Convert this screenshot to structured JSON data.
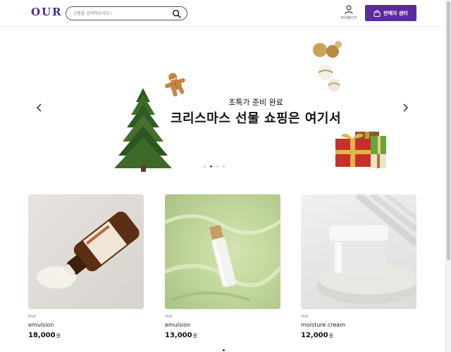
{
  "header": {
    "logo": "OUR",
    "search_placeholder": "상품을 검색해보세요 !",
    "mypage_label": "마이페이지",
    "seller_center_label": "판매자 센터"
  },
  "banner": {
    "subtitle": "초특가 준비 완료",
    "title": "크리스마스 선물 쇼핑은 여기서",
    "slide_count": 4,
    "active_slide": 2
  },
  "products": [
    {
      "brand": "our",
      "name": "emulsion",
      "price": "18,000",
      "currency": "원"
    },
    {
      "brand": "our",
      "name": "emulsion",
      "price": "13,000",
      "currency": "원"
    },
    {
      "brand": "our",
      "name": "moisture cream",
      "price": "12,000",
      "currency": "원"
    }
  ],
  "colors": {
    "brand_purple": "#5b2a9c",
    "logo_purple": "#4b2a8a",
    "moon_yellow": "#f2c230"
  },
  "icons": {
    "search": "search-icon",
    "moon": "moon-icon",
    "user": "user-icon",
    "bag": "shopping-bag-icon",
    "prev": "chevron-left-icon",
    "next": "chevron-right-icon"
  }
}
